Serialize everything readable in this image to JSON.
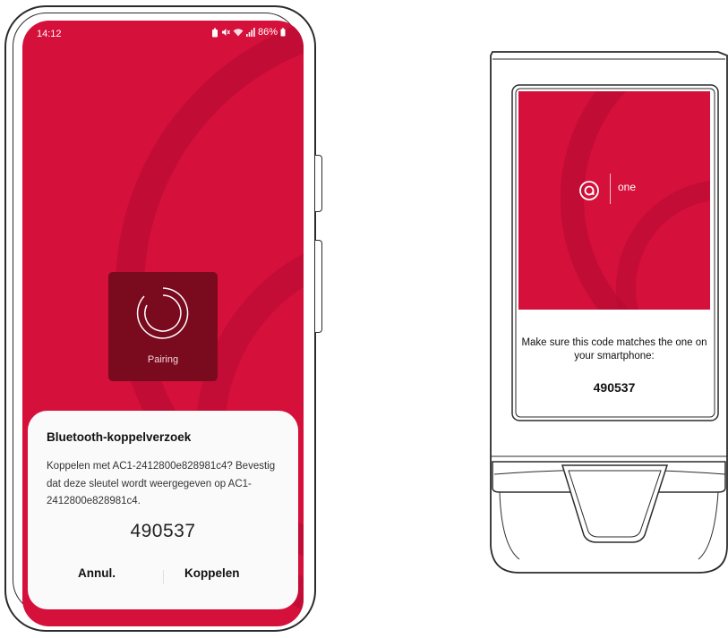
{
  "phone": {
    "status_bar": {
      "time": "14:12",
      "battery": "86%",
      "icons": [
        "battery-saver-icon",
        "mute-icon",
        "wifi-icon",
        "signal-icon",
        "battery-icon"
      ]
    },
    "pairing_label": "Pairing",
    "dialog": {
      "title": "Bluetooth-koppelverzoek",
      "message": "Koppelen met AC1-2412800e828981c4? Bevestig dat deze sleutel wordt weergegeven op AC1-2412800e828981c4.",
      "code": "490537",
      "cancel_label": "Annul.",
      "confirm_label": "Koppelen"
    }
  },
  "device": {
    "logo_text": "one",
    "message": "Make sure this code matches the one on your smartphone:",
    "code": "490537"
  },
  "colors": {
    "brand_red": "#d5103a",
    "pairing_tile": "#7a0a1e",
    "dialog_bg": "#fafafa"
  }
}
